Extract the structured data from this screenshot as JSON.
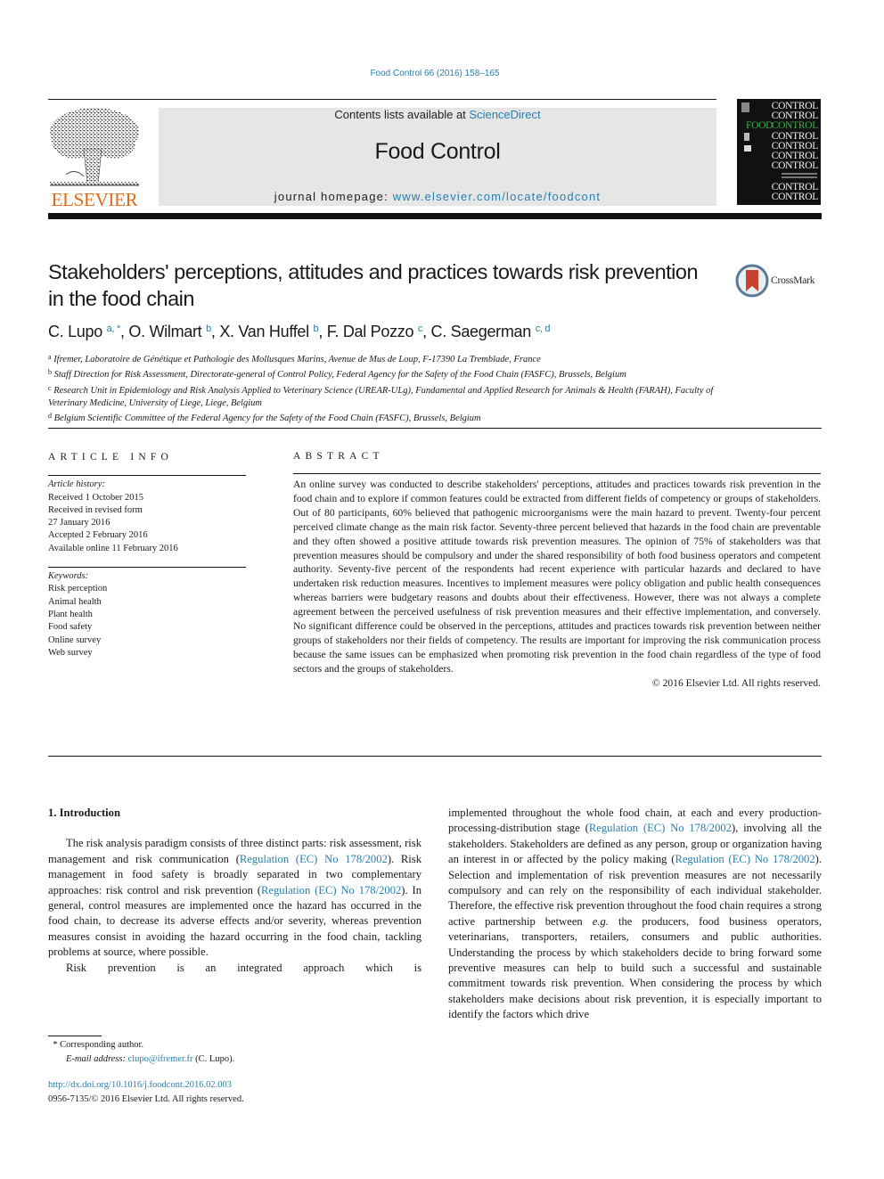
{
  "citation": "Food Control 66 (2016) 158–165",
  "header": {
    "publisher_logo_text": "ELSEVIER",
    "contents_prefix": "Contents lists available at ",
    "contents_link": "ScienceDirect",
    "journal_name": "Food Control",
    "homepage_prefix": "journal homepage: ",
    "homepage_link": "www.elsevier.com/locate/foodcont",
    "cover": {
      "lines": [
        "CONTROL",
        "CONTROL",
        "CONTROL",
        "CONTROL",
        "CONTROL",
        "CONTROL",
        "CONTROL",
        "CONTROL",
        "CONTROL"
      ],
      "food_label": "FOOD",
      "accent_color": "#3fae49"
    }
  },
  "article": {
    "title": "Stakeholders' perceptions, attitudes and practices towards risk prevention in the food chain",
    "crossmark_label": "CrossMark",
    "authors": [
      {
        "name": "C. Lupo",
        "sup": "a, *",
        "sep": ", "
      },
      {
        "name": "O. Wilmart",
        "sup": "b",
        "sep": ", "
      },
      {
        "name": "X. Van Huffel",
        "sup": "b",
        "sep": ", "
      },
      {
        "name": "F. Dal Pozzo",
        "sup": "c",
        "sep": ", "
      },
      {
        "name": "C. Saegerman",
        "sup": "c, d",
        "sep": ""
      }
    ],
    "affiliations": [
      {
        "sup": "a",
        "text": "Ifremer, Laboratoire de Génétique et Pathologie des Mollusques Marins, Avenue de Mus de Loup, F-17390 La Tremblade, France"
      },
      {
        "sup": "b",
        "text": "Staff Direction for Risk Assessment, Directorate-general of Control Policy, Federal Agency for the Safety of the Food Chain (FASFC), Brussels, Belgium"
      },
      {
        "sup": "c",
        "text": "Research Unit in Epidemiology and Risk Analysis Applied to Veterinary Science (UREAR-ULg), Fundamental and Applied Research for Animals & Health (FARAH), Faculty of Veterinary Medicine, University of Liege, Liege, Belgium"
      },
      {
        "sup": "d",
        "text": "Belgium Scientific Committee of the Federal Agency for the Safety of the Food Chain (FASFC), Brussels, Belgium"
      }
    ]
  },
  "article_info": {
    "heading": "ARTICLE INFO",
    "history_label": "Article history:",
    "history": [
      "Received 1 October 2015",
      "Received in revised form",
      "27 January 2016",
      "Accepted 2 February 2016",
      "Available online 11 February 2016"
    ],
    "keywords_label": "Keywords:",
    "keywords": [
      "Risk perception",
      "Animal health",
      "Plant health",
      "Food safety",
      "Online survey",
      "Web survey"
    ]
  },
  "abstract": {
    "heading": "ABSTRACT",
    "text": "An online survey was conducted to describe stakeholders' perceptions, attitudes and practices towards risk prevention in the food chain and to explore if common features could be extracted from different fields of competency or groups of stakeholders. Out of 80 participants, 60% believed that pathogenic microorganisms were the main hazard to prevent. Twenty-four percent perceived climate change as the main risk factor. Seventy-three percent believed that hazards in the food chain are preventable and they often showed a positive attitude towards risk prevention measures. The opinion of 75% of stakeholders was that prevention measures should be compulsory and under the shared responsibility of both food business operators and competent authority. Seventy-five percent of the respondents had recent experience with particular hazards and declared to have undertaken risk reduction measures. Incentives to implement measures were policy obligation and public health consequences whereas barriers were budgetary reasons and doubts about their effectiveness. However, there was not always a complete agreement between the perceived usefulness of risk prevention measures and their effective implementation, and conversely. No significant difference could be observed in the perceptions, attitudes and practices towards risk prevention between neither groups of stakeholders nor their fields of competency. The results are important for improving the risk communication process because the same issues can be emphasized when promoting risk prevention in the food chain regardless of the type of food sectors and the groups of stakeholders.",
    "copyright": "© 2016 Elsevier Ltd. All rights reserved."
  },
  "body": {
    "section_heading": "1.  Introduction",
    "p1": {
      "t1": "The risk analysis paradigm consists of three distinct parts: risk assessment, risk management and risk communication (",
      "l1": "Regulation (EC) No 178/2002",
      "t2": "). Risk management in food safety is broadly separated in two complementary approaches: risk control and risk prevention (",
      "l2": "Regulation (EC) No 178/2002",
      "t3": "). In general, control measures are implemented once the hazard has occurred in the food chain, to decrease its adverse effects and/or severity, whereas prevention measures consist in avoiding the hazard occurring in the food chain, tackling problems at source, where possible."
    },
    "p2_start": "Risk prevention is an integrated approach which is",
    "p2_cont": {
      "t1": "implemented throughout the whole food chain, at each and every production-processing-distribution stage (",
      "l1": "Regulation (EC) No 178/2002",
      "t2": "), involving all the stakeholders. Stakeholders are defined as any person, group or organization having an interest in or affected by the policy making (",
      "l2": "Regulation (EC) No 178/2002",
      "t3": "). Selection and implementation of risk prevention measures are not necessarily compulsory and can rely on the responsibility of each individual stakeholder. Therefore, the effective risk prevention throughout the food chain requires a strong active partnership between ",
      "eg": "e.g.",
      "t4": " the producers, food business operators, veterinarians, transporters, retailers, consumers and public authorities. Understanding the process by which stakeholders decide to bring forward some preventive measures can help to build such a successful and sustainable commitment towards risk prevention. When considering the process by which stakeholders make decisions about risk prevention, it is especially important to identify the factors which drive"
    }
  },
  "footnotes": {
    "corresponding_mark": "*",
    "corresponding": "Corresponding author.",
    "email_label": "E-mail address: ",
    "email": "clupo@ifremer.fr",
    "email_suffix": " (C. Lupo).",
    "doi": "http://dx.doi.org/10.1016/j.foodcont.2016.02.003",
    "issn": "0956-7135/© 2016 Elsevier Ltd. All rights reserved."
  },
  "colors": {
    "link": "#2a7fab",
    "elsevier_orange": "#e06a15",
    "header_box": "#e6e6e6"
  }
}
